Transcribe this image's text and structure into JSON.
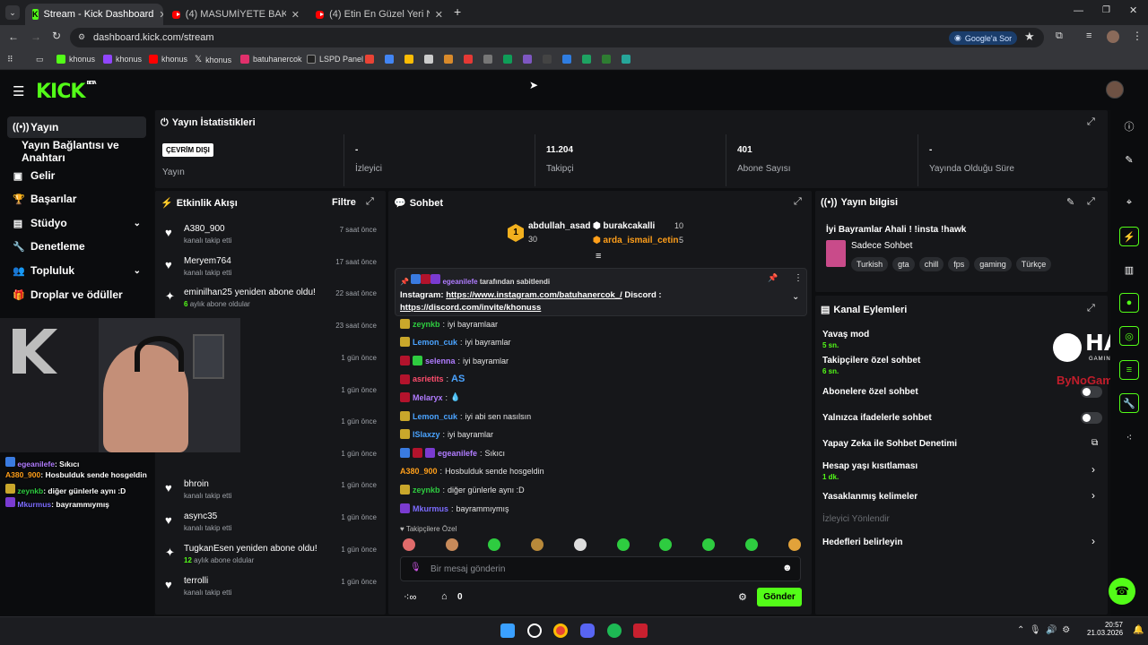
{
  "browser": {
    "tabs": [
      {
        "title": "Stream - Kick Dashboard",
        "icon": "kick-favicon"
      },
      {
        "title": "(4) MASUMİYETE BAK! - MASUMİ",
        "icon": "youtube-favicon"
      },
      {
        "title": "(4) Etin En Güzel Yeri Neresi | Et",
        "icon": "youtube-favicon"
      }
    ],
    "url": "dashboard.kick.com/stream",
    "google_button": "Google'a Sor",
    "bookmarks": [
      "khonus",
      "khonus",
      "khonus",
      "khonus",
      "batuhanercok",
      "LSPD Panel"
    ]
  },
  "header": {
    "logo": "KICK",
    "logo_sup": "BETA"
  },
  "sidebar": {
    "items": [
      {
        "label": "Yayın",
        "icon": "broadcast-icon",
        "active": true
      },
      {
        "label": "Yayın Bağlantısı ve Anahtarı",
        "icon": ""
      },
      {
        "label": "Gelir",
        "icon": "money-icon"
      },
      {
        "label": "Başarılar",
        "icon": "trophy-icon"
      },
      {
        "label": "Stüdyo",
        "icon": "studio-icon",
        "chevron": true
      },
      {
        "label": "Denetleme",
        "icon": "wrench-icon"
      },
      {
        "label": "Topluluk",
        "icon": "community-icon",
        "chevron": true
      },
      {
        "label": "Droplar ve ödüller",
        "icon": "gift-icon"
      }
    ]
  },
  "stats": {
    "title": "Yayın İstatistikleri",
    "status_badge": "ÇEVRİM DIŞI",
    "items": [
      {
        "value": "",
        "label": "Yayın"
      },
      {
        "value": "-",
        "label": "İzleyici"
      },
      {
        "value": "11.204",
        "label": "Takipçi"
      },
      {
        "value": "401",
        "label": "Abone Sayısı"
      },
      {
        "value": "-",
        "label": "Yayında Olduğu Süre"
      }
    ]
  },
  "activity": {
    "title": "Etkinlik Akışı",
    "filter": "Filtre",
    "items": [
      {
        "name": "A380_900",
        "sub": "kanalı takip etti",
        "time": "7 saat önce",
        "icon": "heart-icon"
      },
      {
        "name": "Meryem764",
        "sub": "kanalı takip etti",
        "time": "17 saat önce",
        "icon": "heart-icon"
      },
      {
        "name": "eminilhan25 yeniden abone oldu!",
        "sub_num": "6",
        "sub": "aylık abone oldular",
        "time": "22 saat önce",
        "icon": "star-icon"
      },
      {
        "name": "",
        "sub": "",
        "time": "23 saat önce",
        "icon": ""
      },
      {
        "name": "",
        "sub": "",
        "time": "1 gün önce",
        "icon": ""
      },
      {
        "name": "",
        "sub": "",
        "time": "1 gün önce",
        "icon": ""
      },
      {
        "name": "",
        "sub": "",
        "time": "1 gün önce",
        "icon": ""
      },
      {
        "name": "",
        "sub": "",
        "time": "1 gün önce",
        "icon": ""
      },
      {
        "name": "bhroin",
        "sub": "kanalı takip etti",
        "time": "1 gün önce",
        "icon": "heart-icon"
      },
      {
        "name": "async35",
        "sub": "kanalı takip etti",
        "time": "1 gün önce",
        "icon": "heart-icon"
      },
      {
        "name": "TugkanEsen yeniden abone oldu!",
        "sub_num": "12",
        "sub": "aylık abone oldular",
        "time": "1 gün önce",
        "icon": "star-icon"
      },
      {
        "name": "terrolli",
        "sub": "kanalı takip etti",
        "time": "1 gün önce",
        "icon": "heart-icon"
      }
    ]
  },
  "chat": {
    "title": "Sohbet",
    "leaders": [
      {
        "name": "abdullah_asad",
        "count": "30"
      },
      {
        "name": "burakcakalli",
        "count": "10"
      },
      {
        "name": "arda_ismail_cetin",
        "count": "5"
      }
    ],
    "pinned": {
      "by_user": "egeanilefe",
      "by_suffix": "tarafından sabitlendi",
      "text_prefix": "Instagram:",
      "link1": "https://www.instagram.com/batuhanercok_/",
      "mid": "Discord :",
      "link2": "https://discord.com/invite/khonuss"
    },
    "messages": [
      {
        "user": "zeynkb",
        "text": "iyi bayramlaar",
        "color": "#2ecc40",
        "badges": [
          "bk"
        ]
      },
      {
        "user": "Lemon_cuk",
        "text": "iyi bayramlar",
        "color": "#4aa3ff",
        "badges": [
          "bk"
        ]
      },
      {
        "user": "selenna",
        "text": "iyi bayramlar",
        "color": "#b07cff",
        "badges": [
          "br",
          "bg"
        ]
      },
      {
        "user": "asrietits",
        "text": "AS",
        "color": "#ff4d6d",
        "badges": [
          "br"
        ]
      },
      {
        "user": "Melaryx",
        "text": "💧",
        "color": "#b07cff",
        "badges": [
          "br"
        ]
      },
      {
        "user": "Lemon_cuk",
        "text": "iyi abi sen nasılsın",
        "color": "#4aa3ff",
        "badges": [
          "bk"
        ]
      },
      {
        "user": "lSlaxzy",
        "text": "iyi bayramlar",
        "color": "#4aa3ff",
        "badges": [
          "bk"
        ]
      },
      {
        "user": "egeanilefe",
        "text": "Sıkıcı",
        "color": "#b07cff",
        "badges": [
          "bb",
          "br",
          "bp"
        ]
      },
      {
        "user": "A380_900",
        "text": "Hosbulduk sende hosgeldin",
        "color": "#ff9f1a",
        "badges": []
      },
      {
        "user": "zeynkb",
        "text": "diğer günlerle aynı :D",
        "color": "#2ecc40",
        "badges": [
          "bk"
        ]
      },
      {
        "user": "Mkurmus",
        "text": "bayrammıymış",
        "color": "#7c6cff",
        "badges": [
          "bp"
        ]
      }
    ],
    "emote_label": "Takipçilere Özel",
    "input_placeholder": "Bir mesaj gönderin",
    "points": "0",
    "send_button": "Gönder"
  },
  "stream_info": {
    "title": "Yayın bilgisi",
    "stream_title": "İyi Bayramlar Ahali ! !insta !hawk",
    "category": "Sadece Sohbet",
    "tags": [
      "Turkish",
      "gta",
      "chill",
      "fps",
      "gaming",
      "Türkçe"
    ]
  },
  "channel_actions": {
    "title": "Kanal Eylemleri",
    "slow_mode": {
      "label": "Yavaş mod",
      "value": "5 sn."
    },
    "followers_only": {
      "label": "Takipçilere özel sohbet",
      "value": "6 sn."
    },
    "subs_only": "Abonelere özel sohbet",
    "emotes_only": "Yalnızca ifadelerle sohbet",
    "ai_mod": "Yapay Zeka ile Sohbet Denetimi",
    "age_limit": {
      "label": "Hesap yaşı kısıtlaması",
      "value": "1 dk."
    },
    "banned_words": "Yasaklanmış kelimeler",
    "redirect": "İzleyici Yönlendir",
    "goals": "Hedefleri belirleyin"
  },
  "overlay": {
    "sponsor": "HAWK",
    "sponsor_sub": "GAMING CHAIR",
    "sponsor2": "ByNoGame",
    "chat": [
      {
        "user": "egeanilefe",
        "text": "Sıkıcı",
        "color": "#b07cff"
      },
      {
        "user": "A380_900",
        "text": "Hosbulduk sende hosgeldin",
        "color": "#ff9f1a"
      },
      {
        "user": "zeynkb",
        "text": "diğer günlerle aynı :D",
        "color": "#2ecc40"
      },
      {
        "user": "Mkurmus",
        "text": "bayrammıymış",
        "color": "#7c6cff"
      }
    ]
  },
  "taskbar": {
    "time": "20:57",
    "date": "21.03.2026"
  },
  "colors": {
    "accent": "#53fc18",
    "panel": "#16171a",
    "bg": "#0d0e10"
  }
}
